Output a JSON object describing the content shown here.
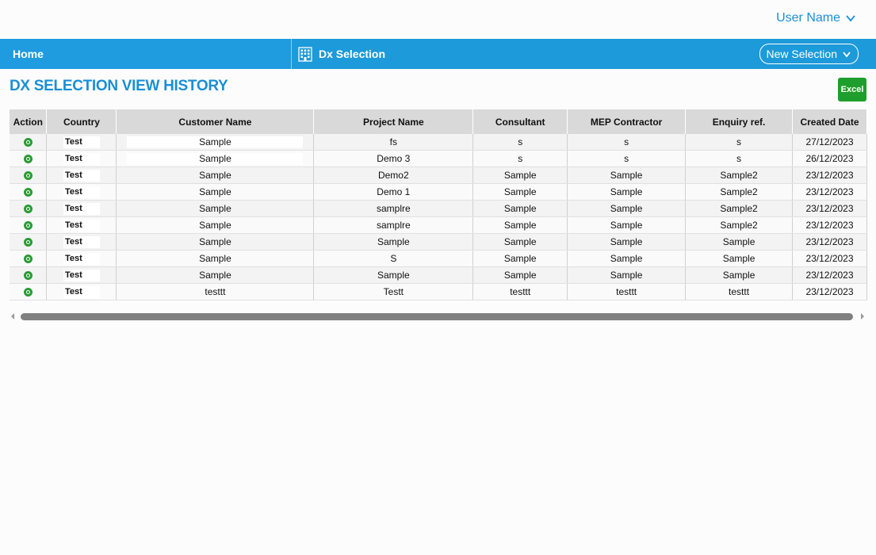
{
  "header": {
    "user_name": "User Name",
    "chevron_icon": "chevron-down-icon"
  },
  "nav": {
    "home_label": "Home",
    "section_label": "Dx Selection",
    "section_icon": "building-icon",
    "new_selection_label": "New Selection",
    "bar_color": "#1d9ad9"
  },
  "page": {
    "title": "DX SELECTION VIEW HISTORY",
    "excel_label": "Excel",
    "accent_color": "#1a8fd6",
    "excel_color": "#1e9e2c"
  },
  "table": {
    "columns": [
      "Action",
      "Country",
      "Customer Name",
      "Project Name",
      "Consultant",
      "MEP Contractor",
      "Enquiry ref.",
      "Created Date"
    ],
    "rows": [
      {
        "country": "Test",
        "customer": "Sample",
        "project": "fs",
        "consultant": "s",
        "mep": "s",
        "enquiry": "s",
        "date": "27/12/2023"
      },
      {
        "country": "Test",
        "customer": "Sample",
        "project": "Demo 3",
        "consultant": "s",
        "mep": "s",
        "enquiry": "s",
        "date": "26/12/2023"
      },
      {
        "country": "Test",
        "customer": "Sample",
        "project": "Demo2",
        "consultant": "Sample",
        "mep": "Sample",
        "enquiry": "Sample2",
        "date": "23/12/2023"
      },
      {
        "country": "Test",
        "customer": "Sample",
        "project": "Demo 1",
        "consultant": "Sample",
        "mep": "Sample",
        "enquiry": "Sample2",
        "date": "23/12/2023"
      },
      {
        "country": "Test",
        "customer": "Sample",
        "project": "samplre",
        "consultant": "Sample",
        "mep": "Sample",
        "enquiry": "Sample2",
        "date": "23/12/2023"
      },
      {
        "country": "Test",
        "customer": "Sample",
        "project": "samplre",
        "consultant": "Sample",
        "mep": "Sample",
        "enquiry": "Sample2",
        "date": "23/12/2023"
      },
      {
        "country": "Test",
        "customer": "Sample",
        "project": "Sample",
        "consultant": "Sample",
        "mep": "Sample",
        "enquiry": "Sample",
        "date": "23/12/2023"
      },
      {
        "country": "Test",
        "customer": "Sample",
        "project": "S",
        "consultant": "Sample",
        "mep": "Sample",
        "enquiry": "Sample",
        "date": "23/12/2023"
      },
      {
        "country": "Test",
        "customer": "Sample",
        "project": "Sample",
        "consultant": "Sample",
        "mep": "Sample",
        "enquiry": "Sample",
        "date": "23/12/2023"
      },
      {
        "country": "Test",
        "customer": "testtt",
        "project": "Testt",
        "consultant": "testtt",
        "mep": "testtt",
        "enquiry": "testtt",
        "date": "23/12/2023"
      }
    ],
    "action_icon": "view-circle-icon"
  }
}
